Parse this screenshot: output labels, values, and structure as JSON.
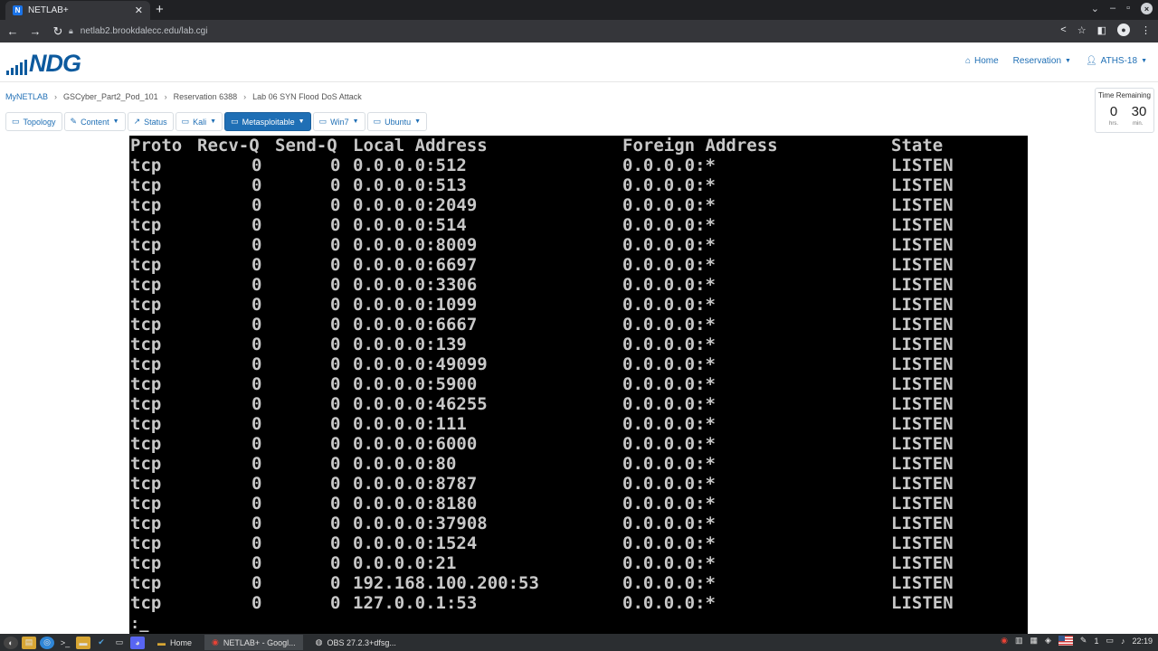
{
  "browser": {
    "tab_title": "NETLAB+",
    "tab_favicon": "N",
    "url": "netlab2.brookdalecc.edu/lab.cgi"
  },
  "header": {
    "logo_text": "NDG",
    "nav": {
      "home": "Home",
      "reservation": "Reservation",
      "user": "ATHS-18"
    }
  },
  "breadcrumb": [
    "MyNETLAB",
    "GSCyber_Part2_Pod_101",
    "Reservation 6388",
    "Lab 06 SYN Flood DoS Attack"
  ],
  "toolbar": {
    "topology": "Topology",
    "content": "Content",
    "status": "Status",
    "kali": "Kali",
    "metasploitable": "Metasploitable",
    "win7": "Win7",
    "ubuntu": "Ubuntu"
  },
  "time_remaining": {
    "label": "Time Remaining",
    "hours": "0",
    "minutes": "30",
    "hours_unit": "hrs.",
    "minutes_unit": "min."
  },
  "console": {
    "header": {
      "proto": "Proto",
      "recv": "Recv-Q",
      "send": "Send-Q",
      "local": "Local Address",
      "foreign": "Foreign Address",
      "state": "State"
    },
    "rows": [
      {
        "proto": "tcp",
        "recv": "0",
        "send": "0",
        "local": "0.0.0.0:512",
        "foreign": "0.0.0.0:*",
        "state": "LISTEN"
      },
      {
        "proto": "tcp",
        "recv": "0",
        "send": "0",
        "local": "0.0.0.0:513",
        "foreign": "0.0.0.0:*",
        "state": "LISTEN"
      },
      {
        "proto": "tcp",
        "recv": "0",
        "send": "0",
        "local": "0.0.0.0:2049",
        "foreign": "0.0.0.0:*",
        "state": "LISTEN"
      },
      {
        "proto": "tcp",
        "recv": "0",
        "send": "0",
        "local": "0.0.0.0:514",
        "foreign": "0.0.0.0:*",
        "state": "LISTEN"
      },
      {
        "proto": "tcp",
        "recv": "0",
        "send": "0",
        "local": "0.0.0.0:8009",
        "foreign": "0.0.0.0:*",
        "state": "LISTEN"
      },
      {
        "proto": "tcp",
        "recv": "0",
        "send": "0",
        "local": "0.0.0.0:6697",
        "foreign": "0.0.0.0:*",
        "state": "LISTEN"
      },
      {
        "proto": "tcp",
        "recv": "0",
        "send": "0",
        "local": "0.0.0.0:3306",
        "foreign": "0.0.0.0:*",
        "state": "LISTEN"
      },
      {
        "proto": "tcp",
        "recv": "0",
        "send": "0",
        "local": "0.0.0.0:1099",
        "foreign": "0.0.0.0:*",
        "state": "LISTEN"
      },
      {
        "proto": "tcp",
        "recv": "0",
        "send": "0",
        "local": "0.0.0.0:6667",
        "foreign": "0.0.0.0:*",
        "state": "LISTEN"
      },
      {
        "proto": "tcp",
        "recv": "0",
        "send": "0",
        "local": "0.0.0.0:139",
        "foreign": "0.0.0.0:*",
        "state": "LISTEN"
      },
      {
        "proto": "tcp",
        "recv": "0",
        "send": "0",
        "local": "0.0.0.0:49099",
        "foreign": "0.0.0.0:*",
        "state": "LISTEN"
      },
      {
        "proto": "tcp",
        "recv": "0",
        "send": "0",
        "local": "0.0.0.0:5900",
        "foreign": "0.0.0.0:*",
        "state": "LISTEN"
      },
      {
        "proto": "tcp",
        "recv": "0",
        "send": "0",
        "local": "0.0.0.0:46255",
        "foreign": "0.0.0.0:*",
        "state": "LISTEN"
      },
      {
        "proto": "tcp",
        "recv": "0",
        "send": "0",
        "local": "0.0.0.0:111",
        "foreign": "0.0.0.0:*",
        "state": "LISTEN"
      },
      {
        "proto": "tcp",
        "recv": "0",
        "send": "0",
        "local": "0.0.0.0:6000",
        "foreign": "0.0.0.0:*",
        "state": "LISTEN"
      },
      {
        "proto": "tcp",
        "recv": "0",
        "send": "0",
        "local": "0.0.0.0:80",
        "foreign": "0.0.0.0:*",
        "state": "LISTEN"
      },
      {
        "proto": "tcp",
        "recv": "0",
        "send": "0",
        "local": "0.0.0.0:8787",
        "foreign": "0.0.0.0:*",
        "state": "LISTEN"
      },
      {
        "proto": "tcp",
        "recv": "0",
        "send": "0",
        "local": "0.0.0.0:8180",
        "foreign": "0.0.0.0:*",
        "state": "LISTEN"
      },
      {
        "proto": "tcp",
        "recv": "0",
        "send": "0",
        "local": "0.0.0.0:37908",
        "foreign": "0.0.0.0:*",
        "state": "LISTEN"
      },
      {
        "proto": "tcp",
        "recv": "0",
        "send": "0",
        "local": "0.0.0.0:1524",
        "foreign": "0.0.0.0:*",
        "state": "LISTEN"
      },
      {
        "proto": "tcp",
        "recv": "0",
        "send": "0",
        "local": "0.0.0.0:21",
        "foreign": "0.0.0.0:*",
        "state": "LISTEN"
      },
      {
        "proto": "tcp",
        "recv": "0",
        "send": "0",
        "local": "192.168.100.200:53",
        "foreign": "0.0.0.0:*",
        "state": "LISTEN"
      },
      {
        "proto": "tcp",
        "recv": "0",
        "send": "0",
        "local": "127.0.0.1:53",
        "foreign": "0.0.0.0:*",
        "state": "LISTEN"
      }
    ],
    "prompt": ":_"
  },
  "taskbar": {
    "tasks": {
      "home": "Home",
      "chrome": "NETLAB+ - Googl...",
      "obs": "OBS 27.2.3+dfsg..."
    },
    "tray_badge": "1",
    "clock": "22:19"
  }
}
